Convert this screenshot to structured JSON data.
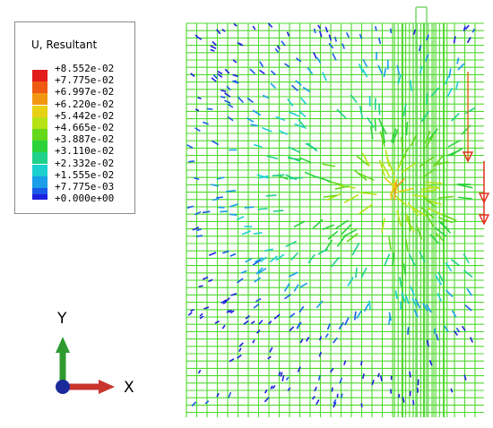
{
  "legend": {
    "title": "U, Resultant",
    "entries": [
      {
        "label": "+8.552e-02",
        "color": "#e21b1b"
      },
      {
        "label": "+7.775e-02",
        "color": "#ee5a12"
      },
      {
        "label": "+6.997e-02",
        "color": "#f39712"
      },
      {
        "label": "+6.220e-02",
        "color": "#e8d014"
      },
      {
        "label": "+5.442e-02",
        "color": "#b7e316"
      },
      {
        "label": "+4.665e-02",
        "color": "#64d81a"
      },
      {
        "label": "+3.887e-02",
        "color": "#2bd23a"
      },
      {
        "label": "+3.110e-02",
        "color": "#1fd18a"
      },
      {
        "label": "+2.332e-02",
        "color": "#1ccfcf"
      },
      {
        "label": "+1.555e-02",
        "color": "#1a9ee8"
      },
      {
        "label": "+7.775e-03",
        "color": "#1a5ae8"
      },
      {
        "label": "+0.000e+00",
        "color": "#1f1fe0"
      }
    ]
  },
  "triad": {
    "y_label": "Y",
    "x_label": "X",
    "y_color": "#2f9b2f",
    "x_color": "#c8352d",
    "origin_color": "#1a2a9a"
  },
  "mesh": {
    "line_color": "#4fd92f",
    "load_arrow_color": "#e07020"
  }
}
